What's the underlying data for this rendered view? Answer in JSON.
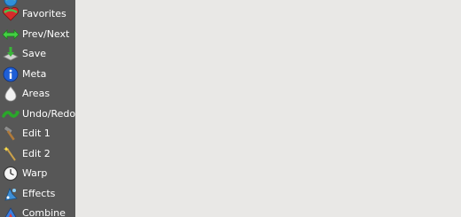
{
  "sidebar": {
    "items": [
      {
        "label": "",
        "icon": "globe-icon"
      },
      {
        "label": "Favorites",
        "icon": "heart-icon"
      },
      {
        "label": "Prev/Next",
        "icon": "double-arrow-icon"
      },
      {
        "label": "Save",
        "icon": "save-icon"
      },
      {
        "label": "Meta",
        "icon": "info-icon"
      },
      {
        "label": "Areas",
        "icon": "areas-icon"
      },
      {
        "label": "Undo/Redo",
        "icon": "undo-redo-icon"
      },
      {
        "label": "Edit 1",
        "icon": "hammer-icon"
      },
      {
        "label": "Edit 2",
        "icon": "magic-wand-icon"
      },
      {
        "label": "Warp",
        "icon": "clock-icon"
      },
      {
        "label": "Effects",
        "icon": "effects-icon"
      },
      {
        "label": "Combine",
        "icon": "combine-icon"
      }
    ]
  },
  "colors": {
    "sidebar_bg": "#575757",
    "main_bg": "#e9e8e6",
    "label_text": "#ffffff"
  }
}
